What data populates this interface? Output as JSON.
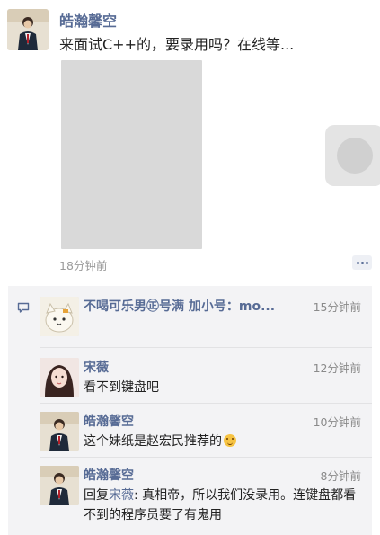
{
  "post": {
    "author": "皓瀚馨空",
    "text": "来面试C++的，要录用吗？在线等...",
    "time": "18分钟前"
  },
  "comments": [
    {
      "name": "不喝可乐男㊣号满 加小号：mo...",
      "time": "15分钟前",
      "text": ""
    },
    {
      "name": "宋薇",
      "time": "12分钟前",
      "text": "看不到键盘吧"
    },
    {
      "name": "皓瀚馨空",
      "time": "10分钟前",
      "text": "这个妹纸是赵宏民推荐的"
    },
    {
      "name": "皓瀚馨空",
      "time": "8分钟前",
      "reply_prefix": "回复",
      "reply_target": "宋薇",
      "reply_sep": ":",
      "text": " 真相帝，所以我们没录用。连键盘都看不到的程序员要了有鬼用"
    }
  ],
  "colors": {
    "name_link": "#576b95",
    "comment_bg": "#f3f3f5"
  }
}
